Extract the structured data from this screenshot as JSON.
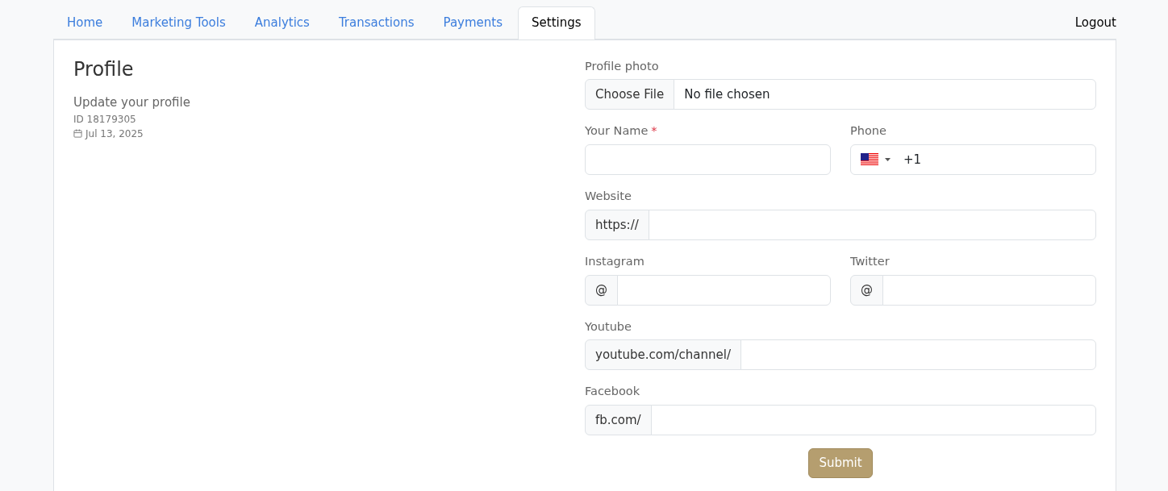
{
  "tabs": [
    {
      "label": "Home",
      "selected": false
    },
    {
      "label": "Marketing Tools",
      "selected": false
    },
    {
      "label": "Analytics",
      "selected": false
    },
    {
      "label": "Transactions",
      "selected": false
    },
    {
      "label": "Payments",
      "selected": false
    },
    {
      "label": "Settings",
      "selected": true
    }
  ],
  "logout": "Logout",
  "profile": {
    "title": "Profile",
    "subtitle": "Update your profile",
    "id": "ID 18179305",
    "date": "Jul 13, 2025"
  },
  "form_rows": [
    [
      {
        "kind": "file",
        "label": "Profile photo",
        "button": "Choose File",
        "value": "No file chosen"
      }
    ],
    [
      {
        "kind": "text",
        "label": "Your Name",
        "required_mark": "*"
      },
      {
        "kind": "phone",
        "label": "Phone",
        "value": "+1"
      }
    ],
    [
      {
        "kind": "prefixed",
        "label": "Website",
        "prefix": "https://"
      }
    ],
    [
      {
        "kind": "prefixed",
        "label": "Instagram",
        "prefix": "@"
      },
      {
        "kind": "prefixed",
        "label": "Twitter",
        "prefix": "@"
      }
    ],
    [
      {
        "kind": "prefixed",
        "label": "Youtube",
        "prefix": "youtube.com/channel/"
      }
    ],
    [
      {
        "kind": "prefixed",
        "label": "Facebook",
        "prefix": "fb.com/"
      }
    ]
  ],
  "submit": "Submit"
}
